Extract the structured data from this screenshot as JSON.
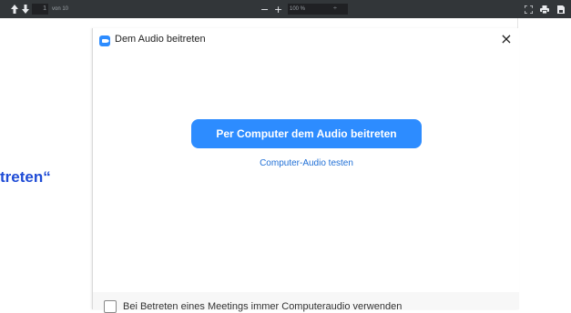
{
  "toolbar": {
    "page_current": "1",
    "page_of": "von 10",
    "zoom_minus": "−",
    "zoom_plus": "+",
    "zoom_value": "100 %",
    "zoom_caret": "÷",
    "icons": [
      "up-arrow-icon",
      "down-arrow-icon",
      "fit-page-icon",
      "print-icon",
      "save-icon"
    ]
  },
  "document": {
    "partial_text": "treten“"
  },
  "dialog": {
    "title": "Dem Audio beitreten",
    "close": "×",
    "join_button": "Per Computer dem Audio beitreten",
    "test_link": "Computer-Audio testen",
    "footer_checkbox_label": "Bei Betreten eines Meetings immer Computeraudio verwenden",
    "accent_color": "#2d8cff"
  }
}
